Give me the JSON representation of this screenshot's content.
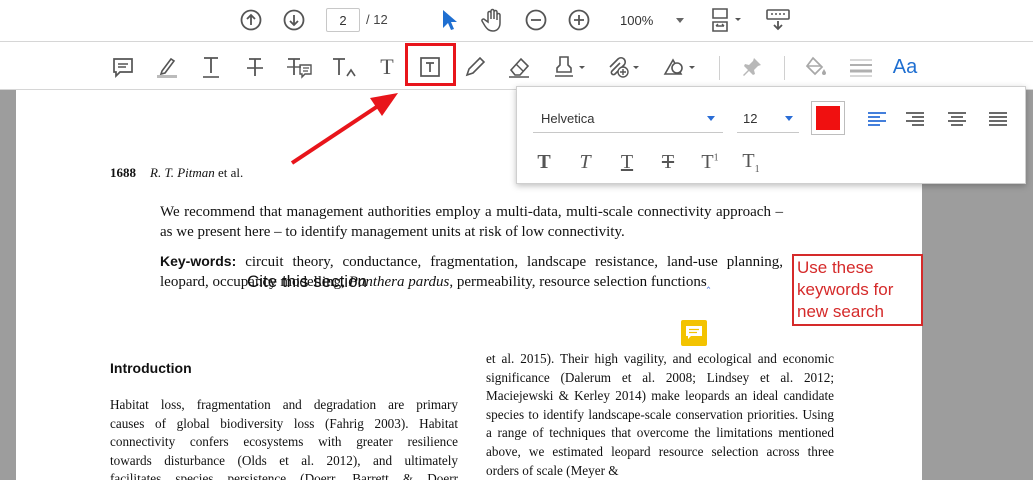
{
  "toolbar": {
    "page_current": "2",
    "page_total": "/ 12",
    "zoom": "100%"
  },
  "text_props": {
    "font": "Helvetica",
    "size": "12",
    "color": "#f01010"
  },
  "document": {
    "running_head_page": "1688",
    "running_head_authors": "R. T. Pitman",
    "running_head_etal": "et al.",
    "abstract_tail": "We recommend that management authorities employ a multi-data, multi-scale connectivity approach – as we present here – to identify management units at risk of low connectivity.",
    "keywords_label": "Key-words:",
    "keywords_a": " circuit theory, conductance, fragmentation, landscape resistance, land-use planning, leopard, occupancy modelling, ",
    "keywords_species": "Panthera pardus",
    "keywords_b": ", permeability, resource selection functions",
    "intro_heading": "Introduction",
    "col_left": [
      "Habitat loss, fragmentation and degradation are primary",
      "causes of global biodiversity loss (Fahrig 2003). Habitat",
      "connectivity confers ecosystems with greater resilience",
      "towards disturbance (Olds et al. 2012), and ultimately",
      "facilitates species persistence (Doerr, Barrett & Doerr"
    ],
    "col_right": "et al. 2015). Their high vagility, and ecological and economic significance (Dalerum et al. 2008; Lindsey et al. 2012; Maciejewski & Kerley 2014) make leopards an ideal candidate species to identify landscape-scale conservation priorities. Using a range of techniques that overcome the limitations mentioned above, we estimated leopard resource selection across three orders of scale (Meyer &"
  },
  "annotations": {
    "cite_note": "Cite this section",
    "red_note": "Use these keywords for new search",
    "red_color": "#d52a2a",
    "highlight_color": "#e8151b",
    "sticky_color": "#f3c300"
  },
  "icons": {
    "top": [
      "arrow-up-circle-icon",
      "arrow-down-circle-icon",
      "select-arrow-icon",
      "hand-icon",
      "zoom-out-icon",
      "zoom-in-icon",
      "page-fit-icon",
      "keyboard-icon"
    ],
    "comment": [
      "sticky-note-icon",
      "highlight-icon",
      "underline-icon",
      "strikethrough-icon",
      "replace-text-icon",
      "insert-text-icon",
      "add-text-icon",
      "text-box-icon",
      "pencil-icon",
      "eraser-icon",
      "stamp-icon",
      "attach-icon",
      "shapes-icon",
      "pin-icon",
      "fill-icon",
      "line-weight-icon",
      "text-properties-icon"
    ]
  }
}
